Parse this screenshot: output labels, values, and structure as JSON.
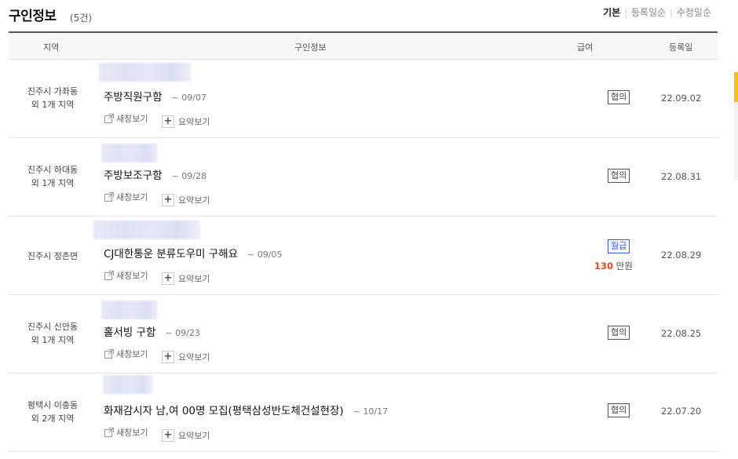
{
  "header": {
    "title": "구인정보",
    "count": "(5건)",
    "sort_options": [
      "기본",
      "등록일순",
      "수정일순"
    ]
  },
  "columns": {
    "region": "지역",
    "info": "구인정보",
    "pay": "급여",
    "date": "등록일"
  },
  "actions": {
    "new_window": "새창보기",
    "summary": "요약보기"
  },
  "rows": [
    {
      "region1": "진주시 가좌동",
      "region2": "외 1개 지역",
      "title": "주방직원구함",
      "deadline": "~ 09/07",
      "pay_badge": "협의",
      "pay_amount": "",
      "pay_unit": "",
      "date": "22.09.02"
    },
    {
      "region1": "진주시 하대동",
      "region2": "외 1개 지역",
      "title": "주방보조구함",
      "deadline": "~ 09/28",
      "pay_badge": "협의",
      "pay_amount": "",
      "pay_unit": "",
      "date": "22.08.31"
    },
    {
      "region1": "진주시 정촌면",
      "region2": "",
      "title": "CJ대한통운 분류도우미 구해요",
      "deadline": "~ 09/05",
      "pay_badge": "월급",
      "pay_amount": "130",
      "pay_unit": "만원",
      "date": "22.08.29"
    },
    {
      "region1": "진주시 신안동",
      "region2": "외 1개 지역",
      "title": "홀서빙 구함",
      "deadline": "~ 09/23",
      "pay_badge": "협의",
      "pay_amount": "",
      "pay_unit": "",
      "date": "22.08.25"
    },
    {
      "region1": "평택시 이충동",
      "region2": "외 2개 지역",
      "title": "화재감시자 남,여 00명 모집(평택삼성반도체건설현장)",
      "deadline": "~ 10/17",
      "pay_badge": "협의",
      "pay_amount": "",
      "pay_unit": "",
      "date": "22.07.20"
    }
  ],
  "colors": {
    "accent_yellow": "#f7c300",
    "salary_red": "#e2471f",
    "badge_blue": "#3a5bd9"
  }
}
